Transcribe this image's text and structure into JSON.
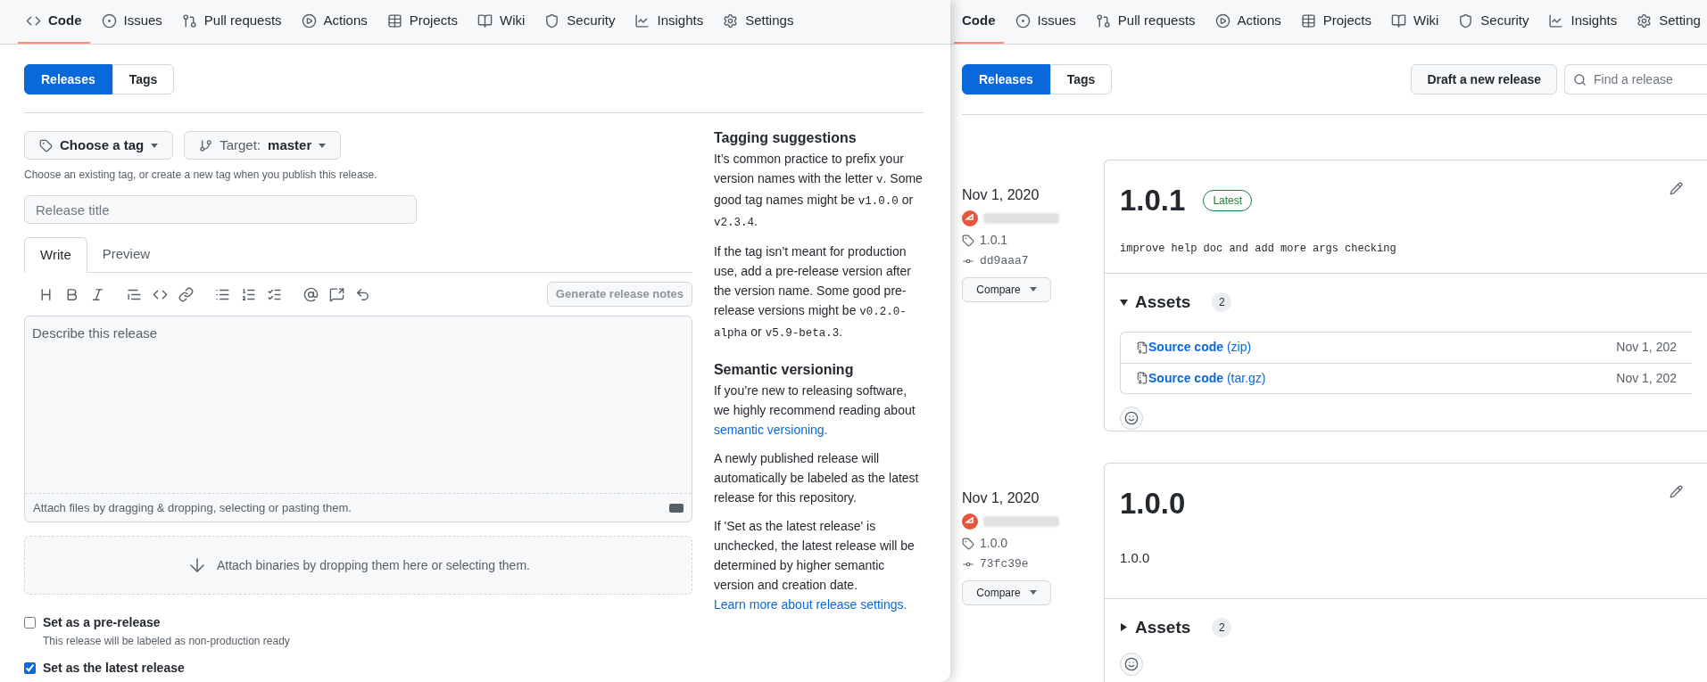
{
  "editor_window": {
    "nav": [
      {
        "label": "Code",
        "selected": true
      },
      {
        "label": "Issues",
        "selected": false
      },
      {
        "label": "Pull requests",
        "selected": false
      },
      {
        "label": "Actions",
        "selected": false
      },
      {
        "label": "Projects",
        "selected": false
      },
      {
        "label": "Wiki",
        "selected": false
      },
      {
        "label": "Security",
        "selected": false
      },
      {
        "label": "Insights",
        "selected": false
      },
      {
        "label": "Settings",
        "selected": false
      }
    ],
    "subnav": [
      {
        "label": "Releases",
        "selected": true
      },
      {
        "label": "Tags",
        "selected": false
      }
    ],
    "tag_button": "Choose a tag",
    "target_button": {
      "label": "Target:",
      "value": "master"
    },
    "tag_hint": "Choose an existing tag, or create a new tag when you publish this release.",
    "title_field": {
      "placeholder": "Release title"
    },
    "editor_tabs": [
      {
        "label": "Write",
        "selected": true
      },
      {
        "label": "Preview",
        "selected": false
      }
    ],
    "generate_button": "Generate release notes",
    "body_field": {
      "placeholder": "Describe this release"
    },
    "attach_hint": "Attach files by dragging & dropping, selecting or pasting them.",
    "binaries_drop": "Attach binaries by dropping them here or selecting them.",
    "options": [
      {
        "label": "Set as a pre-release",
        "description": "This release will be labeled as non-production ready",
        "checked": false
      },
      {
        "label": "Set as the latest release",
        "checked": true
      }
    ],
    "sidebar": [
      {
        "heading": "Tagging suggestions",
        "paragraphs": [
          [
            {
              "kind": "text",
              "text": "It’s common practice to prefix your version names with the letter "
            },
            {
              "kind": "code",
              "text": "v"
            },
            {
              "kind": "text",
              "text": ". Some good tag names might be "
            },
            {
              "kind": "code",
              "text": "v1.0.0"
            },
            {
              "kind": "text",
              "text": " or "
            },
            {
              "kind": "code",
              "text": "v2.3.4"
            },
            {
              "kind": "text",
              "text": "."
            }
          ],
          [
            {
              "kind": "text",
              "text": "If the tag isn’t meant for production use, add a pre-release version after the version name. Some good pre-release versions might be "
            },
            {
              "kind": "code",
              "text": "v0.2.0-alpha"
            },
            {
              "kind": "text",
              "text": " or "
            },
            {
              "kind": "code",
              "text": "v5.9-beta.3"
            },
            {
              "kind": "text",
              "text": "."
            }
          ]
        ]
      },
      {
        "heading": "Semantic versioning",
        "paragraphs": [
          [
            {
              "kind": "text",
              "text": "If you’re new to releasing software, we highly recommend reading about "
            },
            {
              "kind": "link",
              "text": "semantic versioning."
            }
          ],
          [
            {
              "kind": "text",
              "text": "A newly published release will automatically be labeled as the latest release for this repository."
            }
          ],
          [
            {
              "kind": "text",
              "text": "If 'Set as the latest release' is unchecked, the latest release will be determined by higher semantic version and creation date. "
            },
            {
              "kind": "link",
              "text": "Learn"
            },
            {
              "kind": "link",
              "text": "more about release settings."
            }
          ]
        ]
      }
    ]
  },
  "releases_window": {
    "nav": [
      {
        "label": "Code",
        "selected": true
      },
      {
        "label": "Issues",
        "selected": false
      },
      {
        "label": "Pull requests",
        "selected": false
      },
      {
        "label": "Actions",
        "selected": false
      },
      {
        "label": "Projects",
        "selected": false
      },
      {
        "label": "Wiki",
        "selected": false
      },
      {
        "label": "Security",
        "selected": false
      },
      {
        "label": "Insights",
        "selected": false
      },
      {
        "label": "Setting",
        "selected": false
      }
    ],
    "subnav": [
      {
        "label": "Releases",
        "selected": true
      },
      {
        "label": "Tags",
        "selected": false
      }
    ],
    "draft_button": "Draft a new release",
    "search": {
      "placeholder": "Find a release"
    },
    "releases": [
      {
        "date": "Nov 1, 2020",
        "tag": "1.0.1",
        "commit": "dd9aaa7",
        "compare": "Compare",
        "title": "1.0.1",
        "badge": "Latest",
        "body": "improve help doc and add more args checking",
        "monospace": true,
        "assets": {
          "label": "Assets",
          "count": "2",
          "expanded": true,
          "items": [
            {
              "name": "Source code",
              "ext": "(zip)",
              "date": "Nov 1, 202"
            },
            {
              "name": "Source code",
              "ext": "(tar.gz)",
              "date": "Nov 1, 202"
            }
          ]
        }
      },
      {
        "date": "Nov 1, 2020",
        "tag": "1.0.0",
        "commit": "73fc39e",
        "compare": "Compare",
        "title": "1.0.0",
        "body": "1.0.0",
        "monospace": false,
        "assets": {
          "label": "Assets",
          "count": "2",
          "expanded": false
        }
      }
    ]
  }
}
